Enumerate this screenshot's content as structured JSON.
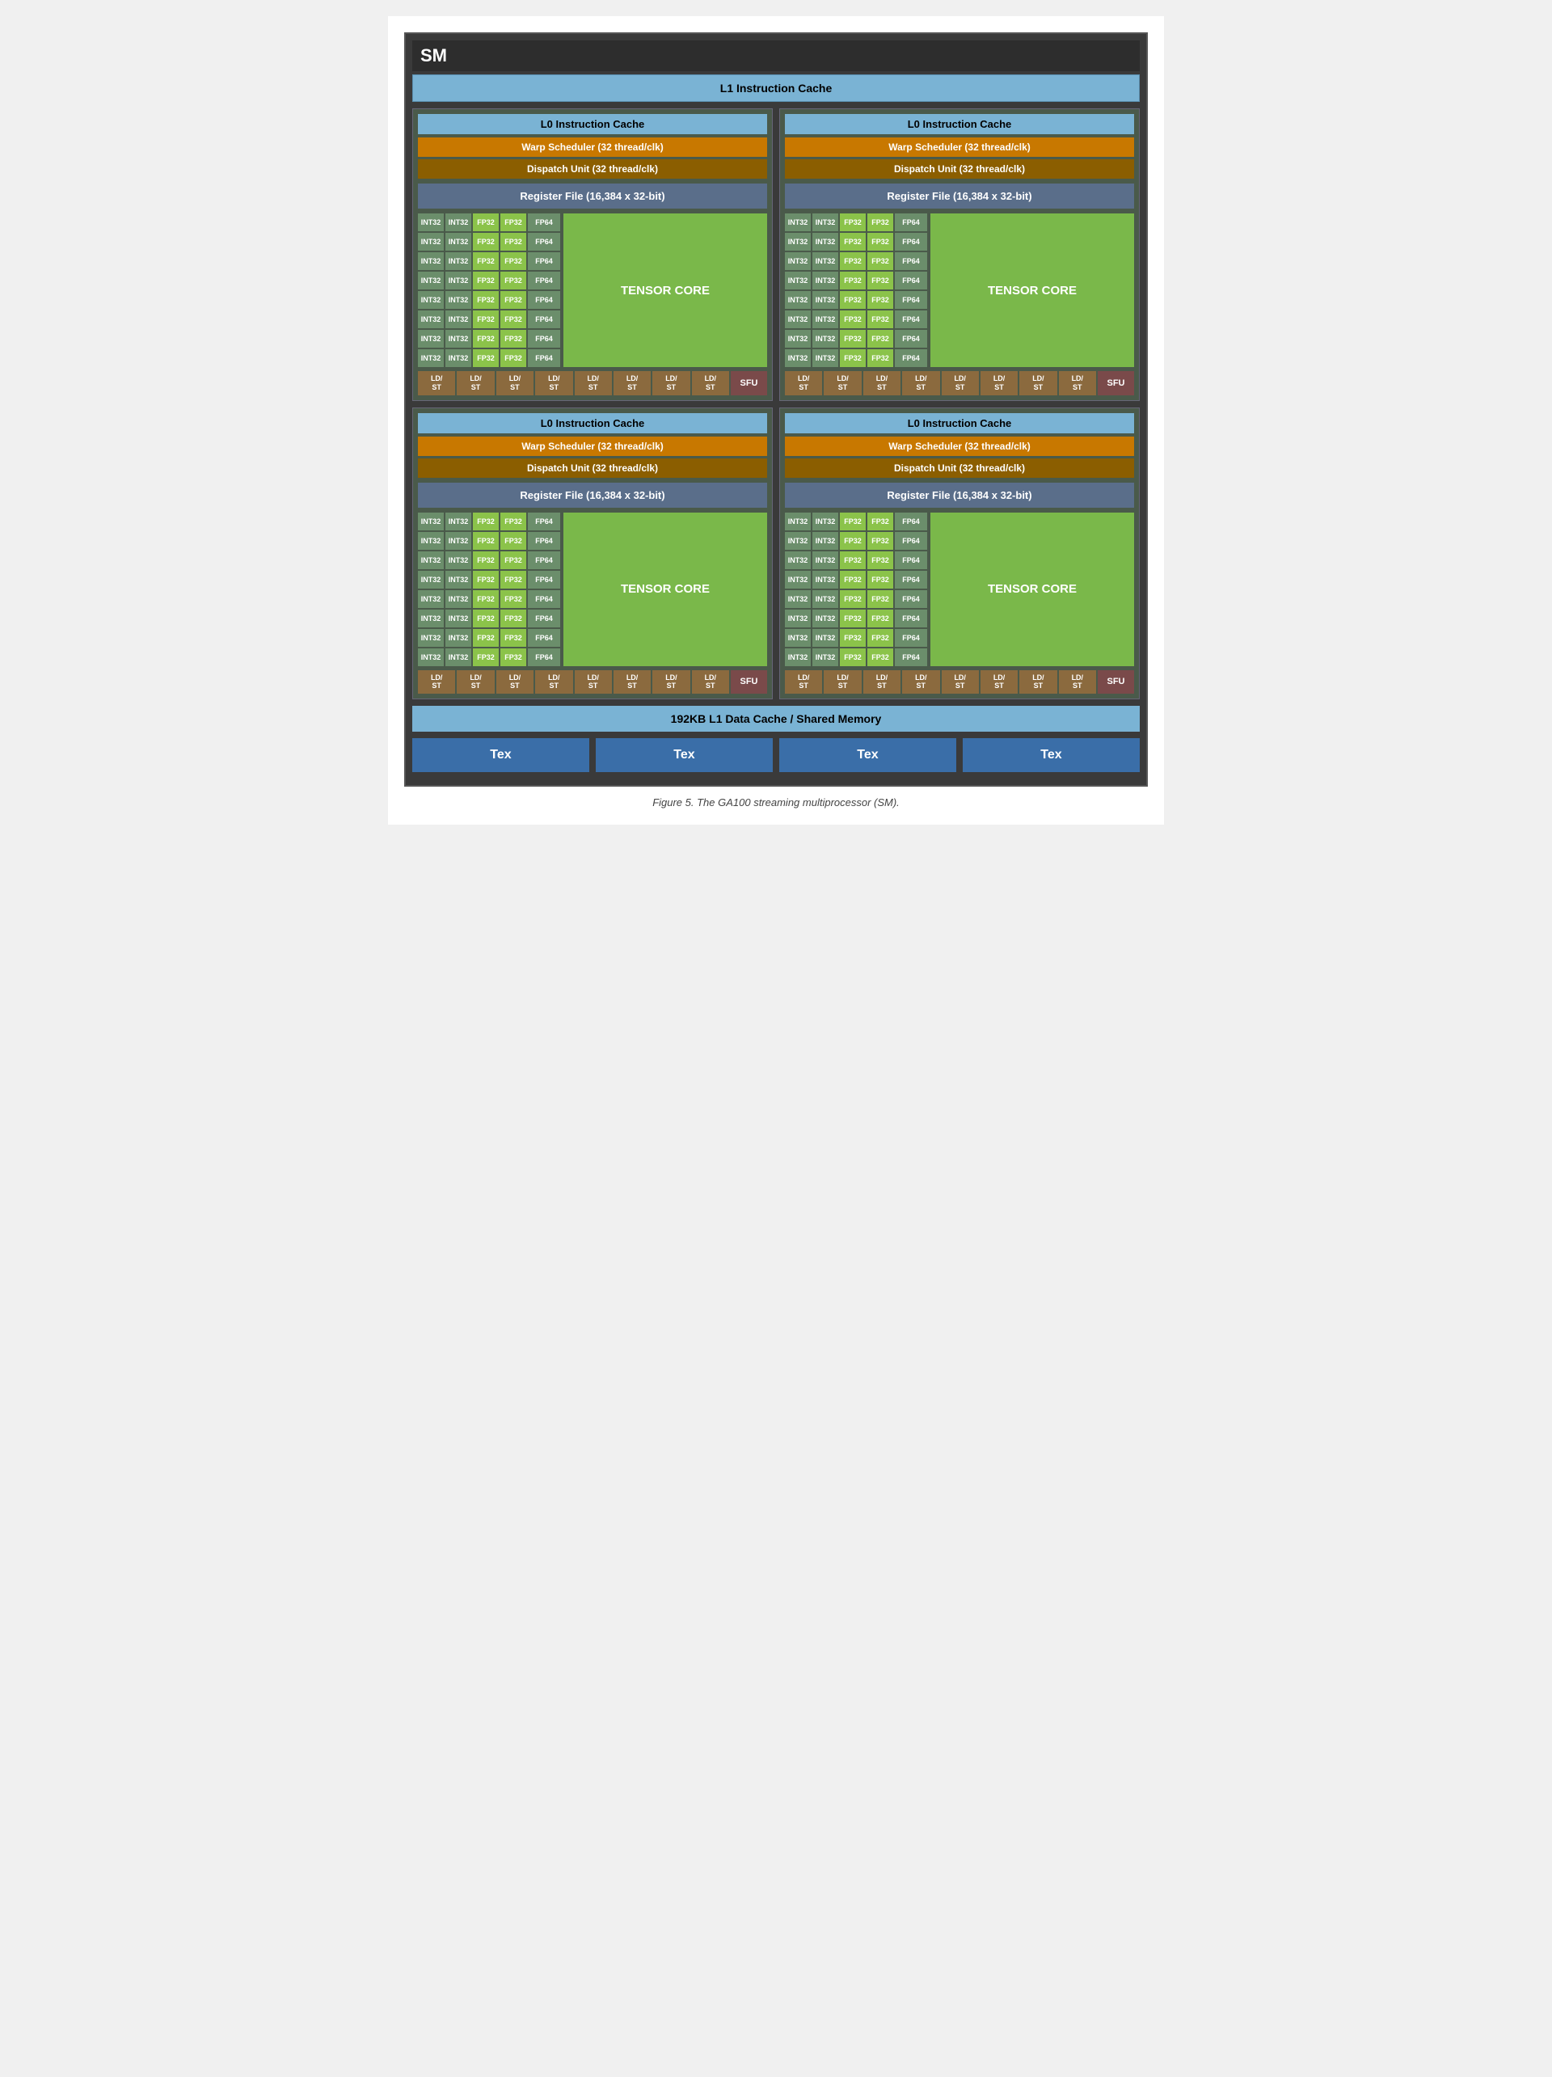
{
  "title": "SM",
  "l1_instruction_cache": "L1 Instruction Cache",
  "l1_data_cache": "192KB L1 Data Cache / Shared Memory",
  "figure_caption": "Figure 5. The GA100 streaming multiprocessor (SM).",
  "quadrants": [
    {
      "id": "q1",
      "l0_cache": "L0 Instruction Cache",
      "warp_scheduler": "Warp Scheduler (32 thread/clk)",
      "dispatch_unit": "Dispatch Unit (32 thread/clk)",
      "register_file": "Register File (16,384 x 32-bit)",
      "tensor_core": "TENSOR CORE",
      "sfu": "SFU"
    },
    {
      "id": "q2",
      "l0_cache": "L0 Instruction Cache",
      "warp_scheduler": "Warp Scheduler (32 thread/clk)",
      "dispatch_unit": "Dispatch Unit (32 thread/clk)",
      "register_file": "Register File (16,384 x 32-bit)",
      "tensor_core": "TENSOR CORE",
      "sfu": "SFU"
    },
    {
      "id": "q3",
      "l0_cache": "L0 Instruction Cache",
      "warp_scheduler": "Warp Scheduler (32 thread/clk)",
      "dispatch_unit": "Dispatch Unit (32 thread/clk)",
      "register_file": "Register File (16,384 x 32-bit)",
      "tensor_core": "TENSOR CORE",
      "sfu": "SFU"
    },
    {
      "id": "q4",
      "l0_cache": "L0 Instruction Cache",
      "warp_scheduler": "Warp Scheduler (32 thread/clk)",
      "dispatch_unit": "Dispatch Unit (32 thread/clk)",
      "register_file": "Register File (16,384 x 32-bit)",
      "tensor_core": "TENSOR CORE",
      "sfu": "SFU"
    }
  ],
  "tex_units": [
    "Tex",
    "Tex",
    "Tex",
    "Tex"
  ],
  "compute_rows": 8,
  "int32_label": "INT32",
  "fp32_label": "FP32",
  "fp64_label": "FP64",
  "ldst_label": "LD/\nST",
  "ldst_count": 8
}
